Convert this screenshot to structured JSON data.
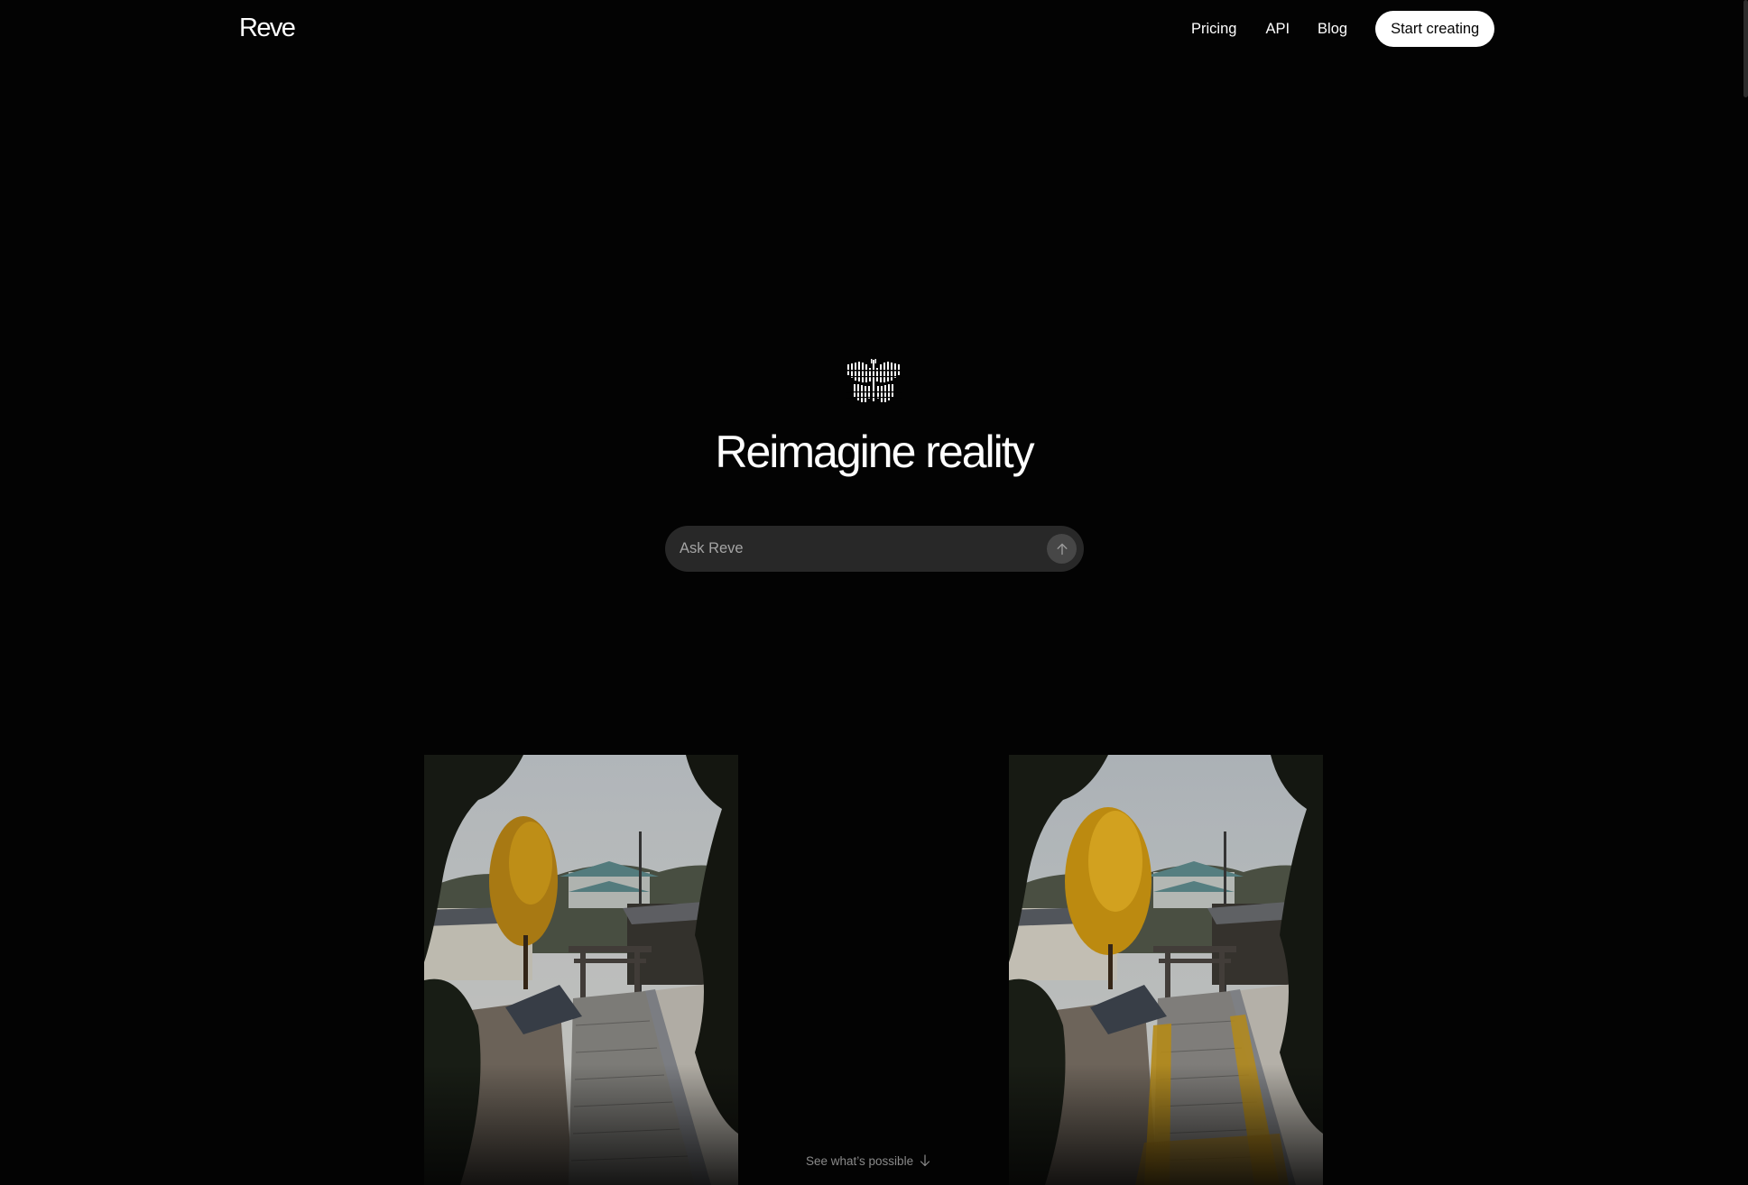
{
  "header": {
    "logo": "Reve",
    "nav": {
      "pricing": "Pricing",
      "api": "API",
      "blog": "Blog"
    },
    "cta_label": "Start creating"
  },
  "hero": {
    "icon": "butterfly-icon",
    "headline": "Reimagine reality",
    "search": {
      "placeholder": "Ask Reve",
      "value": "",
      "submit_icon": "arrow-up-icon"
    }
  },
  "showcase": {
    "images": [
      {
        "name": "original-photo",
        "description_icon": "photo"
      },
      {
        "name": "edited-photo",
        "description_icon": "photo"
      }
    ]
  },
  "footer_hint": {
    "label": "See what’s possible",
    "icon": "arrow-down-icon"
  },
  "colors": {
    "background": "#030303",
    "text": "#ffffff",
    "cta_bg": "#ffffff",
    "search_bg": "#282828",
    "muted": "#8a8a8a",
    "foliage_yellow": "#d9a21b"
  }
}
